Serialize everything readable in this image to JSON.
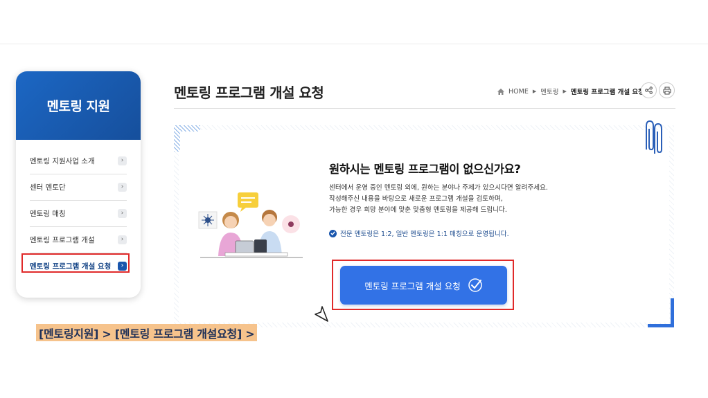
{
  "sidebar": {
    "title": "멘토링 지원",
    "items": [
      {
        "label": "멘토링 지원사업 소개",
        "active": false
      },
      {
        "label": "센터 멘토단",
        "active": false
      },
      {
        "label": "멘토링 매칭",
        "active": false
      },
      {
        "label": "멘토링 프로그램 개설",
        "active": false
      },
      {
        "label": "멘토링 프로그램 개설 요청",
        "active": true
      }
    ],
    "chevron": "›"
  },
  "header": {
    "title": "멘토링 프로그램 개설 요청",
    "breadcrumb": {
      "home": "HOME",
      "sep": "▶",
      "level1": "멘토링",
      "current": "멘토링 프로그램 개설 요청"
    },
    "tools": [
      "share-icon",
      "print-icon"
    ]
  },
  "card": {
    "heading": "원하시는 멘토링 프로그램이 없으신가요?",
    "description": [
      "센터에서 운영 중인 멘토링 외에, 원하는 분야나 주제가 있으시다면 알려주세요.",
      "작성해주신 내용을 바탕으로 새로운 프로그램 개설을 검토하며,",
      "가능한 경우 희망 분야에 맞춘 맞춤형 멘토링을 제공해 드립니다."
    ],
    "notice": "전문 멘토링은 1:2, 일반 멘토링은 1:1 매칭으로 운영됩니다.",
    "button_label": "멘토링 프로그램 개설 요청"
  },
  "caption": "[멘토링지원] > [멘토링 프로그램 개설요청] >",
  "colors": {
    "primary": "#3272e6",
    "sidebar_head": "#1a5bb3",
    "highlight_box": "#e02a2a",
    "caption_bg": "#f6c38c"
  }
}
